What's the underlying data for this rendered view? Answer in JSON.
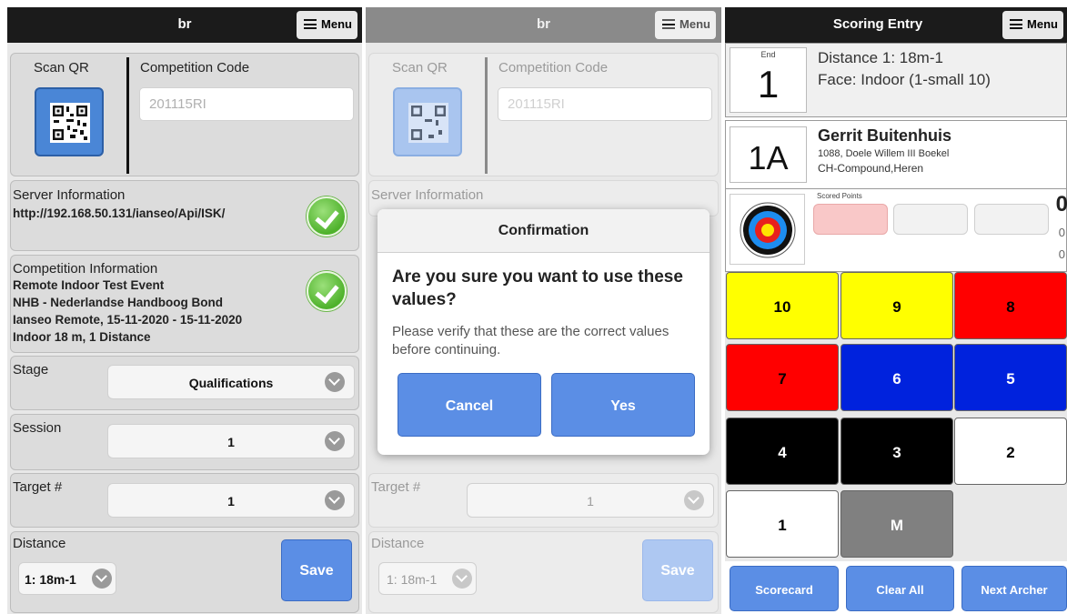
{
  "colors": {
    "topbar": "#1b1b1b",
    "accent_blue": "#5b8ee5",
    "success_green": "#4fb22c"
  },
  "setup": {
    "header_title": "br",
    "menu_label": "Menu",
    "scan_qr_label": "Scan QR",
    "qr_icon": "qr-code-icon",
    "competition_code_label": "Competition Code",
    "competition_code_value": "201115RI",
    "server_info_label": "Server Information",
    "server_url": "http://192.168.50.131/ianseo/Api/ISK/",
    "competition_info_label": "Competition Information",
    "competition_lines": [
      "Remote Indoor Test Event",
      "NHB - Nederlandse Handboog Bond",
      "Ianseo Remote, 15-11-2020 - 15-11-2020",
      "Indoor 18 m, 1 Distance"
    ],
    "stage_label": "Stage",
    "stage_value": "Qualifications",
    "session_label": "Session",
    "session_value": "1",
    "target_label": "Target #",
    "target_value": "1",
    "distance_label": "Distance",
    "distance_value": "1: 18m-1",
    "save_label": "Save"
  },
  "confirm": {
    "title": "Confirmation",
    "question": "Are you sure you want to use these values?",
    "message": "Please verify that these are the correct values before continuing.",
    "cancel_label": "Cancel",
    "yes_label": "Yes"
  },
  "scoring": {
    "header_title": "Scoring Entry",
    "menu_label": "Menu",
    "end_label": "End",
    "end_value": "1",
    "distance_line": "Distance 1: 18m-1",
    "face_line": "Face: Indoor (1-small 10)",
    "target_code": "1A",
    "archer_name": "Gerrit Buitenhuis",
    "archer_club": "1088, Doele Willem III Boekel",
    "archer_division": "CH-Compound,Heren",
    "scored_points_label": "Scored Points",
    "totals": [
      "0",
      "0",
      "0"
    ],
    "keys": [
      {
        "label": "10",
        "bg": "#ffff00",
        "fg": "#000000"
      },
      {
        "label": "9",
        "bg": "#ffff00",
        "fg": "#000000"
      },
      {
        "label": "8",
        "bg": "#ff0000",
        "fg": "#000000"
      },
      {
        "label": "7",
        "bg": "#ff0000",
        "fg": "#000000"
      },
      {
        "label": "6",
        "bg": "#0022dd",
        "fg": "#ffffff"
      },
      {
        "label": "5",
        "bg": "#0022dd",
        "fg": "#ffffff"
      },
      {
        "label": "4",
        "bg": "#000000",
        "fg": "#ffffff"
      },
      {
        "label": "3",
        "bg": "#000000",
        "fg": "#ffffff"
      },
      {
        "label": "2",
        "bg": "#ffffff",
        "fg": "#000000"
      },
      {
        "label": "1",
        "bg": "#ffffff",
        "fg": "#000000"
      },
      {
        "label": "M",
        "bg": "#808080",
        "fg": "#ffffff"
      }
    ],
    "scorecard_label": "Scorecard",
    "clear_all_label": "Clear All",
    "next_archer_label": "Next Archer"
  }
}
